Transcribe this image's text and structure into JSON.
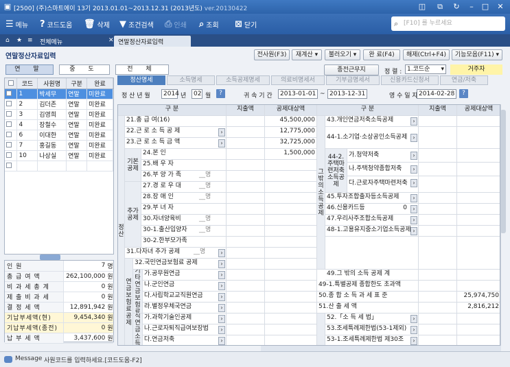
{
  "window": {
    "title": "[2500] (주)스마트에이   13기  2013.01.01~2013.12.31 (2013년도)",
    "version": "ver.20130422"
  },
  "toolbar": {
    "menu": "메뉴",
    "code_help": "코드도움",
    "delete": "삭제",
    "condition_search": "조건검색",
    "print": "인쇄",
    "lookup": "조회",
    "close": "닫기",
    "search_placeholder": "[F10] 를 누르세요"
  },
  "tabs": {
    "all_menu": "전체메뉴",
    "current": "연말정산자료입력"
  },
  "form": {
    "title": "연말정산자료입력",
    "buttons": {
      "all_emp": "전사원(F3)",
      "recalc": "재계산",
      "import": "불러오기",
      "done": "완 료(F4)",
      "cancel": "해제(Ctrl+F4)",
      "functions": "기능모음(F11)"
    },
    "seg": [
      "연 말",
      "중 도",
      "전 체"
    ],
    "prev_work": "종전근무지",
    "sort_label": "정 렬 :",
    "sort_value": "1.코드순",
    "resident": "거주자"
  },
  "left_grid": {
    "headers": [
      "코드",
      "사원명",
      "구분",
      "완료"
    ],
    "rows": [
      {
        "code": "1",
        "name": "박세무",
        "type": "연말",
        "done": "미완료"
      },
      {
        "code": "2",
        "name": "김더존",
        "type": "연말",
        "done": "미완료"
      },
      {
        "code": "3",
        "name": "김영희",
        "type": "연말",
        "done": "미완료"
      },
      {
        "code": "4",
        "name": "장철수",
        "type": "연말",
        "done": "미완료"
      },
      {
        "code": "6",
        "name": "이대한",
        "type": "연말",
        "done": "미완료"
      },
      {
        "code": "7",
        "name": "홍길동",
        "type": "연말",
        "done": "미완료"
      },
      {
        "code": "10",
        "name": "나상실",
        "type": "연말",
        "done": "미완료"
      }
    ]
  },
  "summary": [
    {
      "label": "인 원",
      "value": "7",
      "unit": "명"
    },
    {
      "label": "총 급 여 액",
      "value": "262,100,000",
      "unit": "원"
    },
    {
      "label": "비 과 세 총 계",
      "value": "0",
      "unit": "원"
    },
    {
      "label": "제 출 비 과 세",
      "value": "0",
      "unit": "원"
    },
    {
      "label": "결 정 세 액",
      "value": "12,891,942",
      "unit": "원"
    },
    {
      "label": "기납부세액(현)",
      "value": "9,454,340",
      "unit": "원"
    },
    {
      "label": "기납부세액(종전)",
      "value": "0",
      "unit": "원"
    },
    {
      "label": "납 부 세 액",
      "value": "3,437,600",
      "unit": "원"
    }
  ],
  "right_tabs": [
    "정산명세",
    "소득명세",
    "소득공제명세",
    "의료비명세서",
    "기부금명세서",
    "신용카드신청서",
    "연금/저축"
  ],
  "info": {
    "settle_label": "정 산 년 월",
    "year": "2014",
    "year_unit": "년",
    "month": "02",
    "month_unit": "월",
    "attr_label": "귀 속 기 간",
    "from": "2013-01-01",
    "to": "2013-12-31",
    "receipt_label": "영 수 일 자",
    "receipt": "2014-02-28"
  },
  "main": {
    "headers": {
      "gubun": "구 분",
      "paid": "지출액",
      "target": "공제대상액"
    },
    "left": {
      "r21": "21.총 급 여(16)",
      "r21_target": "45,500,000",
      "r22": "22.근 로 소 득 공 제",
      "r22_target": "12,775,000",
      "r23": "23.근 로 소 득 금 액",
      "r23_target": "32,725,000",
      "g_basic": "기본공제",
      "r24": "24.본 인",
      "r24_target": "1,500,000",
      "r25": "25.배 우 자",
      "r26": "26.부 양 가 족",
      "r26_unit": "명",
      "g_add": "추가공제",
      "r27": "27.경 로 우 대",
      "r27_unit": "명",
      "r28": "28.장 애 인",
      "r28_unit": "명",
      "r29": "29.부 녀 자",
      "r30": "30.자녀양육비",
      "r30_unit": "명",
      "r30_1": "30-1.출산입양자",
      "r30_1_unit": "명",
      "r30_2": "30-2.한부모가족",
      "r31": "31.다자녀 추가 공제",
      "r31_unit": "명",
      "g_tax": "정산",
      "g_pension": "연금보험료공제",
      "r32": "32.국민연금보험료 공제",
      "g_32_1": "32-1.기타연금보험료공제",
      "r32a": "가.공무원연금",
      "r32b": "나.군인연금",
      "r32c": "다.사립학교교직원연금",
      "r32d": "라.별정우체국연금",
      "g_33": "33.퇴직연금소득공제",
      "r33a": "가.과학기술인공제",
      "r33b": "나.근로자퇴직급여보장법",
      "r33c": "다.연금저축"
    },
    "right": {
      "r43": "43.개인연금저축소득공제",
      "r44_1": "44-1.소기업·소상공인소득공제",
      "g_44_2": "44-2.주택마련저축소득공제",
      "g_other": "그 밖의 소득공제",
      "r44a": "가.청약저축",
      "r44b": "나.주택청약종합저축",
      "r44c": "다.근로자주택마련저축",
      "r45": "45.투자조합출자등소득공제",
      "r46": "46.신용카드등",
      "r46_val": "0",
      "r47": "47.우리사주조합소득공제",
      "r48_1": "48-1.고용유지중소기업소득공제",
      "r49": "49.그 밖의 소득 공제 계",
      "r49_1": "49-1.특별공제 종합한도 초과액",
      "r50": "50.종 합 소 득 과 세 표 준",
      "r50_target": "25,974,750",
      "r51": "51.산 출 세 액",
      "r51_target": "2,816,212",
      "r52": "52.「소 득 세 법」",
      "r53": "53.조세특례제한법(53-1제외)",
      "r53_1": "53-1.조세특례제한법 제30조"
    }
  },
  "status": {
    "label": "Message",
    "text": "사원코드를 입력하세요.[코드도움-F2]"
  }
}
